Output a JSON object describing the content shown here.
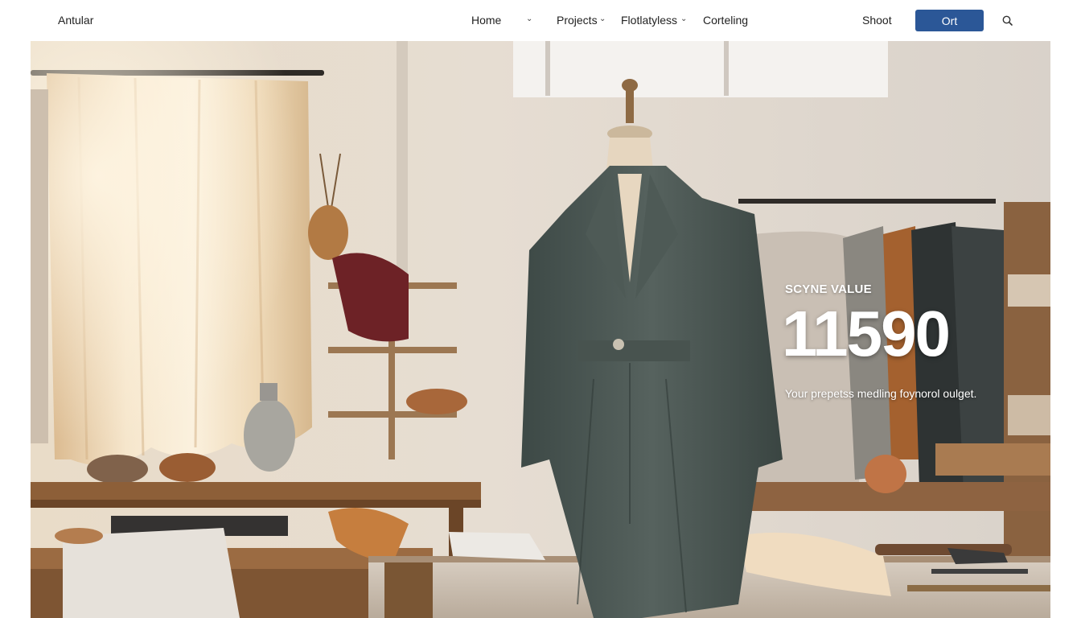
{
  "header": {
    "brand": "Antular",
    "nav": [
      {
        "label": "Home"
      },
      {
        "label": "Projects"
      },
      {
        "label": "Flotlatyless"
      },
      {
        "label": "Corteling"
      }
    ],
    "shoot_label": "Shoot",
    "cta_label": "Ort"
  },
  "hero": {
    "stat_label": "SCYNE VALUE",
    "stat_value": "11590",
    "stat_desc": "Your prepetss medling foynorol oulget."
  },
  "icons": {
    "chevron": "chevron-down-icon",
    "search": "search-icon"
  },
  "colors": {
    "accent": "#2b5797",
    "background": "#ffffff"
  }
}
